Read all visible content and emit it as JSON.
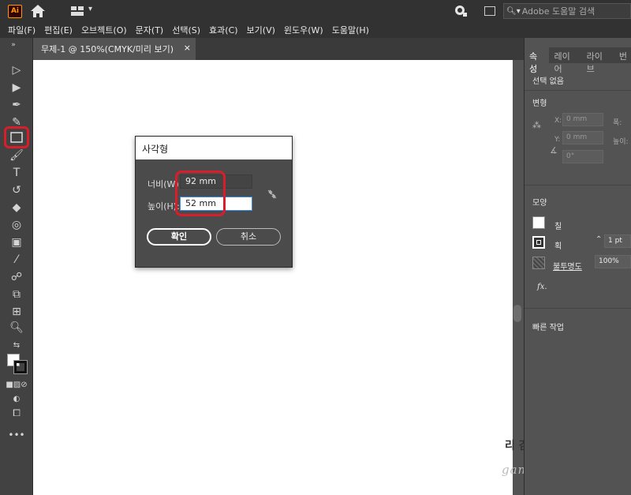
{
  "app": {
    "logo": "Ai",
    "search_placeholder": "Adobe 도움말 검색"
  },
  "menu": [
    "파일(F)",
    "편집(E)",
    "오브젝트(O)",
    "문자(T)",
    "선택(S)",
    "효과(C)",
    "보기(V)",
    "윈도우(W)",
    "도움말(H)"
  ],
  "document": {
    "tab_title": "무제-1 @ 150%(CMYK/미리 보기)",
    "close_glyph": "×"
  },
  "right_panel": {
    "tabs": [
      "속성",
      "레이어",
      "라이브",
      "번"
    ],
    "active_tab": "속성",
    "selection": "선택 없음",
    "transform": {
      "title": "변형",
      "x_label": "X:",
      "x_value": "0 mm",
      "y_label": "Y:",
      "y_value": "0 mm",
      "w_label": "폭:",
      "h_label": "높이:",
      "angle_value": "0°"
    },
    "appearance": {
      "title": "모양",
      "fill_label": "칠",
      "stroke_label": "획",
      "stroke_value": "1 pt",
      "opacity_label": "불투명도",
      "opacity_value": "100%",
      "fx_label": "fx."
    },
    "quick_actions_title": "빠른 작업"
  },
  "dialog": {
    "title": "사각형",
    "width_label": "너비(W):",
    "width_value": "92 mm",
    "height_label": "높이(H):",
    "height_value": "52 mm",
    "ok_label": "확인",
    "cancel_label": "취소"
  },
  "watermark": {
    "text": "리 감성리뷰",
    "url": "gamsungit.co.kr"
  },
  "colors": {
    "highlight": "#d81e2a",
    "logo_orange": "#ff9a00",
    "canvas": "#ffffff"
  }
}
